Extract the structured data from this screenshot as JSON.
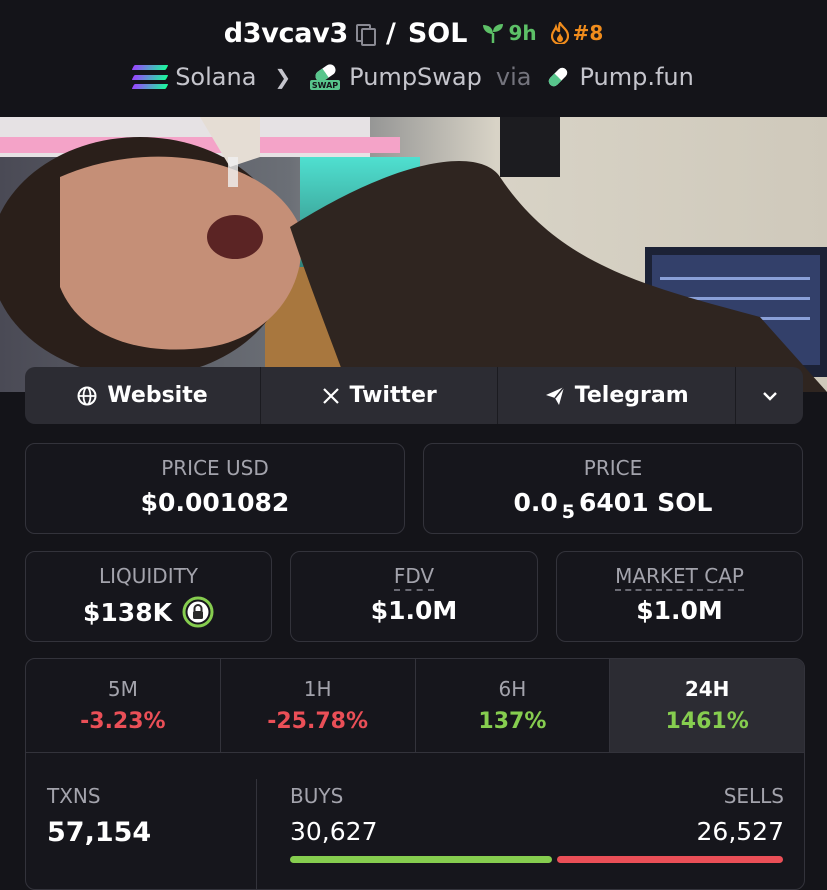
{
  "header": {
    "token_symbol": "d3vcav3",
    "slash": "/",
    "quote_symbol": "SOL",
    "age": "9h",
    "rank": "#8"
  },
  "breadcrumb": {
    "chain": "Solana",
    "dex": "PumpSwap",
    "via": "via",
    "launchpad": "Pump.fun",
    "swap_logo_text": "SWAP"
  },
  "links": {
    "website": "Website",
    "twitter": "Twitter",
    "telegram": "Telegram"
  },
  "price": {
    "usd_label": "PRICE USD",
    "usd_value": "$0.001082",
    "native_label": "PRICE",
    "native_prefix": "0.0",
    "native_zeros": "5",
    "native_digits": "6401 SOL"
  },
  "metrics": {
    "liquidity_label": "LIQUIDITY",
    "liquidity_value": "$138K",
    "fdv_label": "FDV",
    "fdv_value": "$1.0M",
    "mcap_label": "MARKET CAP",
    "mcap_value": "$1.0M"
  },
  "timeframes": [
    {
      "label": "5M",
      "change": "-3.23%",
      "direction": "down"
    },
    {
      "label": "1H",
      "change": "-25.78%",
      "direction": "down"
    },
    {
      "label": "6H",
      "change": "137%",
      "direction": "up"
    },
    {
      "label": "24H",
      "change": "1461%",
      "direction": "up",
      "selected": true
    }
  ],
  "txns": {
    "label": "TXNS",
    "value": "57,154",
    "buys_label": "BUYS",
    "buys_value": "30,627",
    "sells_label": "SELLS",
    "sells_value": "26,527",
    "buy_share": 0.5359
  },
  "colors": {
    "background": "#141419",
    "positive": "#86cd4f",
    "negative": "#ea4f57",
    "age_green": "#5dc067",
    "rank_orange": "#f08c1c"
  }
}
